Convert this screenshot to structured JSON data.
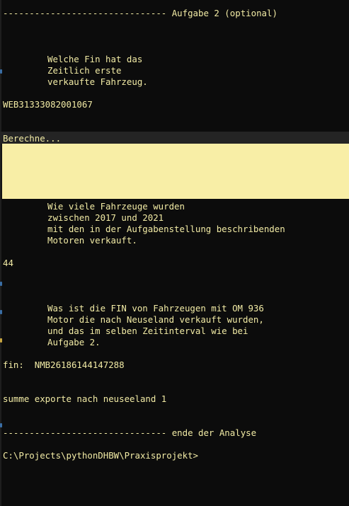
{
  "terminal": {
    "header": "------------------------------- Aufgabe 2 (optional)",
    "q1": [
      "Welche Fin hat das",
      "Zeitlich erste",
      "verkaufte Fahrzeug."
    ],
    "a1": "WEB31333082001067",
    "status": "Berechne...",
    "q2": [
      "Wie viele Fahrzeuge wurden",
      "zwischen 2017 und 2021",
      "mit den in der Aufgabenstellung beschribenden",
      "Motoren verkauft."
    ],
    "a2": "44",
    "q3": [
      "Was ist die FIN von Fahrzeugen mit OM 936",
      "Motor die nach Neuseland verkauft wurden,",
      "und das im selben Zeitinterval wie bei",
      "Aufgabe 2."
    ],
    "a3": "fin:  NMB26186144147288",
    "summary": "summe exporte nach neuseeland 1",
    "footer": "------------------------------- ende der Analyse",
    "prompt": "C:\\Projects\\pythonDHBW\\Praxisprojekt>"
  },
  "colors": {
    "background": "#0c0c0c",
    "text": "#f2eba5",
    "highlight": "#f8eea6"
  }
}
